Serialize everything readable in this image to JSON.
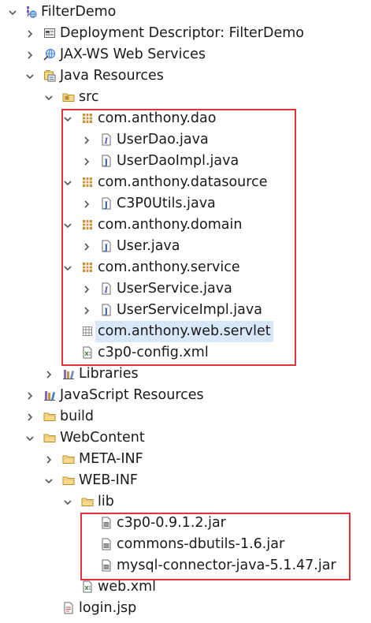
{
  "tree": {
    "rows": [
      {
        "label": "FilterDemo",
        "icon": "web-project-icon",
        "expanded": true
      },
      {
        "label": "Deployment Descriptor: FilterDemo",
        "icon": "deployment-descriptor-icon",
        "expanded": false
      },
      {
        "label": "JAX-WS Web Services",
        "icon": "web-services-icon",
        "expanded": false
      },
      {
        "label": "Java Resources",
        "icon": "java-resources-icon",
        "expanded": true
      },
      {
        "label": "src",
        "icon": "source-folder-icon",
        "expanded": true
      },
      {
        "label": "com.anthony.dao",
        "icon": "package-icon",
        "expanded": true
      },
      {
        "label": "UserDao.java",
        "icon": "java-interface-file-icon",
        "expanded": false
      },
      {
        "label": "UserDaoImpl.java",
        "icon": "java-file-icon",
        "expanded": false
      },
      {
        "label": "com.anthony.datasource",
        "icon": "package-icon",
        "expanded": true
      },
      {
        "label": "C3P0Utils.java",
        "icon": "java-file-icon",
        "expanded": false
      },
      {
        "label": "com.anthony.domain",
        "icon": "package-icon",
        "expanded": true
      },
      {
        "label": "User.java",
        "icon": "java-file-icon",
        "expanded": false
      },
      {
        "label": "com.anthony.service",
        "icon": "package-icon",
        "expanded": true
      },
      {
        "label": "UserService.java",
        "icon": "java-interface-file-icon",
        "expanded": false
      },
      {
        "label": "UserServiceImpl.java",
        "icon": "java-file-icon",
        "expanded": false
      },
      {
        "label": "com.anthony.web.servlet",
        "icon": "empty-package-icon",
        "selected": true
      },
      {
        "label": "c3p0-config.xml",
        "icon": "xml-file-icon"
      },
      {
        "label": "Libraries",
        "icon": "libraries-icon",
        "expanded": false
      },
      {
        "label": "JavaScript Resources",
        "icon": "javascript-resources-icon",
        "expanded": false
      },
      {
        "label": "build",
        "icon": "folder-icon",
        "expanded": false
      },
      {
        "label": "WebContent",
        "icon": "folder-icon",
        "expanded": true
      },
      {
        "label": "META-INF",
        "icon": "folder-icon",
        "expanded": false
      },
      {
        "label": "WEB-INF",
        "icon": "folder-icon",
        "expanded": true
      },
      {
        "label": "lib",
        "icon": "folder-icon",
        "expanded": true
      },
      {
        "label": "c3p0-0.9.1.2.jar",
        "icon": "jar-file-icon"
      },
      {
        "label": "commons-dbutils-1.6.jar",
        "icon": "jar-file-icon"
      },
      {
        "label": "mysql-connector-java-5.1.47.jar",
        "icon": "jar-file-icon"
      },
      {
        "label": "web.xml",
        "icon": "xml-file-icon"
      },
      {
        "label": "login.jsp",
        "icon": "jsp-file-icon"
      }
    ]
  },
  "colors": {
    "highlight_box": "#e0343a",
    "selection": "#d8e8f8"
  }
}
